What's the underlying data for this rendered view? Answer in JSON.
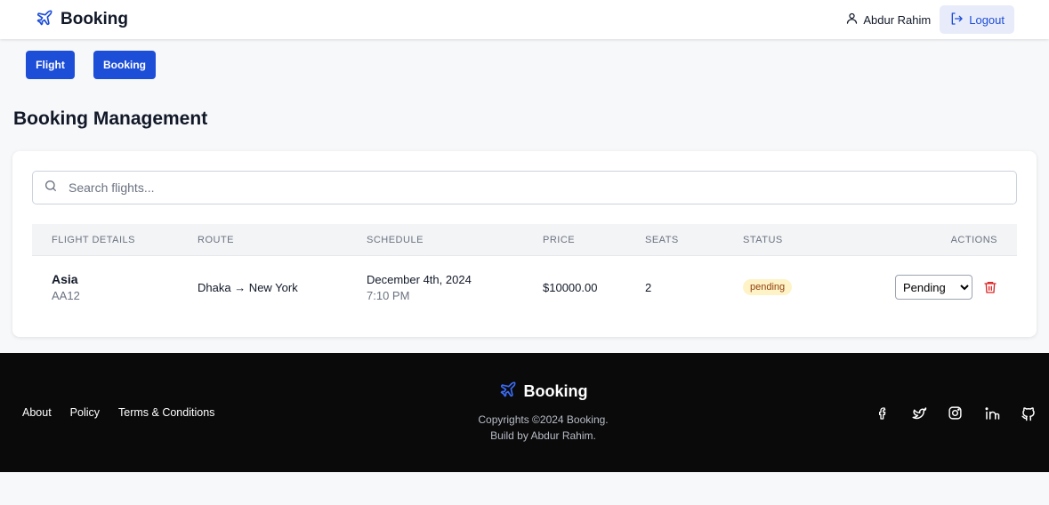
{
  "navbar": {
    "brand": "Booking",
    "user_name": "Abdur Rahim",
    "logout_label": "Logout"
  },
  "subnav": {
    "flight_label": "Flight",
    "booking_label": "Booking"
  },
  "page": {
    "title": "Booking Management"
  },
  "search": {
    "placeholder": "Search flights...",
    "value": ""
  },
  "table": {
    "headers": [
      "FLIGHT DETAILS",
      "ROUTE",
      "SCHEDULE",
      "PRICE",
      "SEATS",
      "STATUS",
      "ACTIONS"
    ],
    "rows": [
      {
        "airline": "Asia",
        "code": "AA12",
        "route": "Dhaka → New York",
        "date": "December 4th, 2024",
        "time": "7:10 PM",
        "price": "$10000.00",
        "seats": "2",
        "status": "pending",
        "status_select": "Pending"
      }
    ]
  },
  "status_options": [
    "Pending"
  ],
  "footer": {
    "links": [
      "About",
      "Policy",
      "Terms & Conditions"
    ],
    "brand": "Booking",
    "copyright": "Copyrights ©2024 Booking.",
    "credit": "Build by Abdur Rahim.",
    "socials": [
      "facebook-icon",
      "twitter-icon",
      "instagram-icon",
      "linkedin-icon",
      "github-icon"
    ]
  },
  "colors": {
    "primary": "#1d4ed8",
    "danger": "#dc2626",
    "pending_bg": "#fef3c7",
    "footer_bg": "#0a0a0a"
  }
}
